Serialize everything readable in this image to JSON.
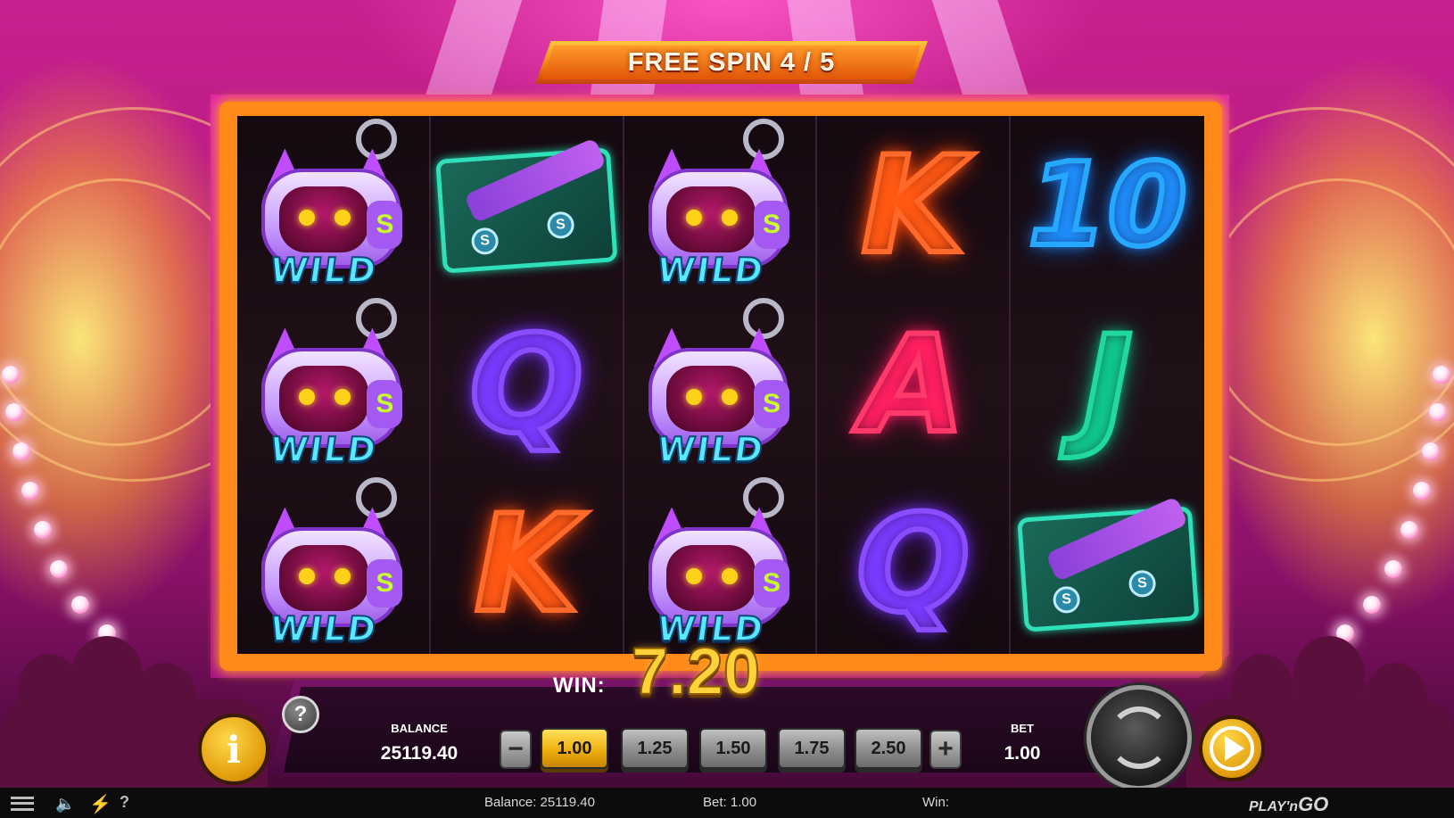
{
  "banner": {
    "free_spin_text": "FREE SPIN 4 / 5"
  },
  "reels": [
    {
      "symbols": [
        "wild",
        "wild",
        "wild"
      ]
    },
    {
      "symbols": [
        "wristband",
        "Q",
        "K"
      ]
    },
    {
      "symbols": [
        "wild",
        "wild",
        "wild"
      ]
    },
    {
      "symbols": [
        "K",
        "A",
        "Q"
      ]
    },
    {
      "symbols": [
        "10",
        "J",
        "wristband"
      ]
    }
  ],
  "symbol_text": {
    "wild_label": "WILD",
    "wild_badge": "S",
    "band_coin": "S",
    "K": "K",
    "A": "A",
    "Q": "Q",
    "J": "J",
    "10": "10"
  },
  "win": {
    "label": "WIN:",
    "value": "7.20"
  },
  "balance": {
    "label": "BALANCE",
    "value": "25119.40"
  },
  "bet": {
    "label": "BET",
    "value": "1.00",
    "minus_label": "−",
    "plus_label": "+",
    "options": [
      "1.00",
      "1.25",
      "1.50",
      "1.75",
      "2.50"
    ],
    "selected": "1.00"
  },
  "buttons": {
    "info_label": "i",
    "help_label": "?"
  },
  "status_bar": {
    "balance_text": "Balance: 25119.40",
    "bet_text": "Bet: 1.00",
    "win_text": "Win:",
    "brand_prefix": "PLAY'n",
    "brand_suffix": "GO",
    "help_label": "?"
  },
  "colors": {
    "accent": "#ff8a1a",
    "frame": "#e22aa6",
    "win_gold": "#ffd23a"
  },
  "icons": [
    "menu-icon",
    "sound-icon",
    "turbo-icon",
    "help-icon",
    "spin-icon",
    "autoplay-icon",
    "info-icon"
  ]
}
